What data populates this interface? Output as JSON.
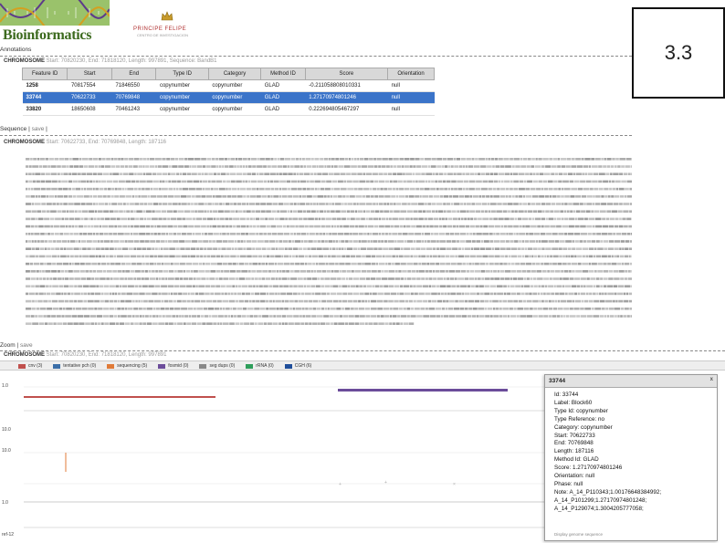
{
  "slide_number": "3.3",
  "header": {
    "brand": "Bioinformatics",
    "institution": "PRINCIPE FELIPE",
    "institution_sub": "CENTRO DE INVESTIGACION"
  },
  "annotations": {
    "title": "Annotations",
    "record_id": "CHROMOSOME",
    "record_meta": "Start: 70820230, End: 71818120, Length: 997891, Sequence: BandB1",
    "columns": [
      "Feature ID",
      "Start",
      "End",
      "Type ID",
      "Category",
      "Method ID",
      "Score",
      "Orientation"
    ],
    "rows": [
      [
        "1258",
        "70817554",
        "71846550",
        "copynumber",
        "copynumber",
        "GLAD",
        "-0.211058808010331",
        "null"
      ],
      [
        "33744",
        "70622733",
        "70769848",
        "copynumber",
        "copynumber",
        "GLAD",
        "1.27170974801246",
        "null"
      ],
      [
        "33820",
        "18650608",
        "70461243",
        "copynumber",
        "copynumber",
        "GLAD",
        "0.222694805467297",
        "null"
      ]
    ],
    "selected_row": 1
  },
  "sequence": {
    "title": "Sequence",
    "link": "save",
    "record_id": "CHROMOSOME",
    "record_meta": "Start: 70622733, End: 70769848, Length: 187116"
  },
  "zoom": {
    "title": "Zoom",
    "link": "save",
    "record_id": "CHROMOSOME",
    "record_meta": "Start: 70820230, End: 71818120, Length: 997891",
    "legend": [
      {
        "label": "cnv (3)",
        "color": "#c0504d"
      },
      {
        "label": "tentative pch (0)",
        "color": "#3b6ea8"
      },
      {
        "label": "sequencing (5)",
        "color": "#e07b39"
      },
      {
        "label": "fosmid (0)",
        "color": "#6b4c9a"
      },
      {
        "label": "seg dups (0)",
        "color": "#888888"
      },
      {
        "label": "rRNA (0)",
        "color": "#2e9e5b"
      },
      {
        "label": "CGH (6)",
        "color": "#1f4e9a"
      }
    ],
    "y_labels": [
      "1.0",
      "10.0",
      "10.0",
      "1.0"
    ],
    "x_label": "ref-12"
  },
  "info_panel": {
    "title": "33744",
    "close": "x",
    "lines": [
      "Id: 33744",
      "Label: Block60",
      "Type Id: copynumber",
      "Type Reference: no",
      "Category: copynumber",
      "Start: 70622733",
      "End: 70769848",
      "Length: 187116",
      "Method Id: GLAD",
      "Score: 1.27170974801246",
      "Orientation: null",
      "Phase: null",
      "Note: A_14_P110343;1.00176648384992;",
      "A_14_P101299;1.27170974801248;",
      "A_14_P129074;1.3004205777058;"
    ],
    "footer": "Display genome sequence"
  }
}
